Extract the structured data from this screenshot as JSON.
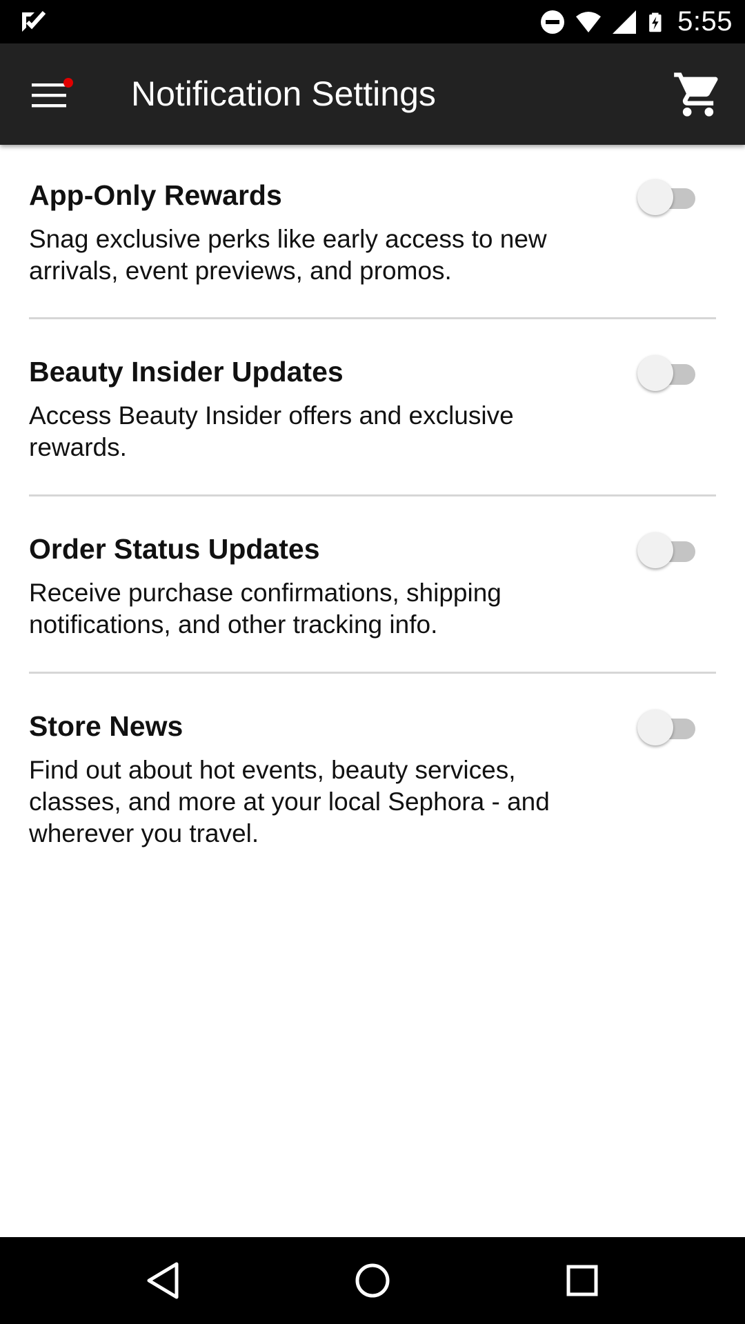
{
  "status_bar": {
    "time": "5:55",
    "icons": [
      "notification-check-icon",
      "do-not-disturb-icon",
      "wifi-icon",
      "signal-icon",
      "battery-charging-icon"
    ]
  },
  "app_bar": {
    "title": "Notification Settings",
    "menu_icon": "hamburger-menu-icon",
    "cart_icon": "shopping-cart-icon",
    "accent_dot_color": "#e10000"
  },
  "settings": [
    {
      "title": "App-Only Rewards",
      "description": "Snag exclusive perks like early access to new arrivals, event previews, and promos.",
      "enabled": false
    },
    {
      "title": "Beauty Insider Updates",
      "description": "Access Beauty Insider offers and exclusive rewards.",
      "enabled": false
    },
    {
      "title": "Order Status Updates",
      "description": "Receive purchase confirmations, shipping notifications, and other tracking info.",
      "enabled": false
    },
    {
      "title": "Store News",
      "description": "Find out about hot events, beauty services, classes, and more at your local Sephora - and wherever you travel.",
      "enabled": false
    }
  ],
  "nav_bar": {
    "icons": [
      "back-icon",
      "home-icon",
      "recents-icon"
    ]
  },
  "colors": {
    "app_bar": "#222222",
    "status_bar": "#000000",
    "divider": "#d6d6d6",
    "toggle_off_track": "#c4c4c4",
    "toggle_off_knob": "#f1f1f1"
  }
}
